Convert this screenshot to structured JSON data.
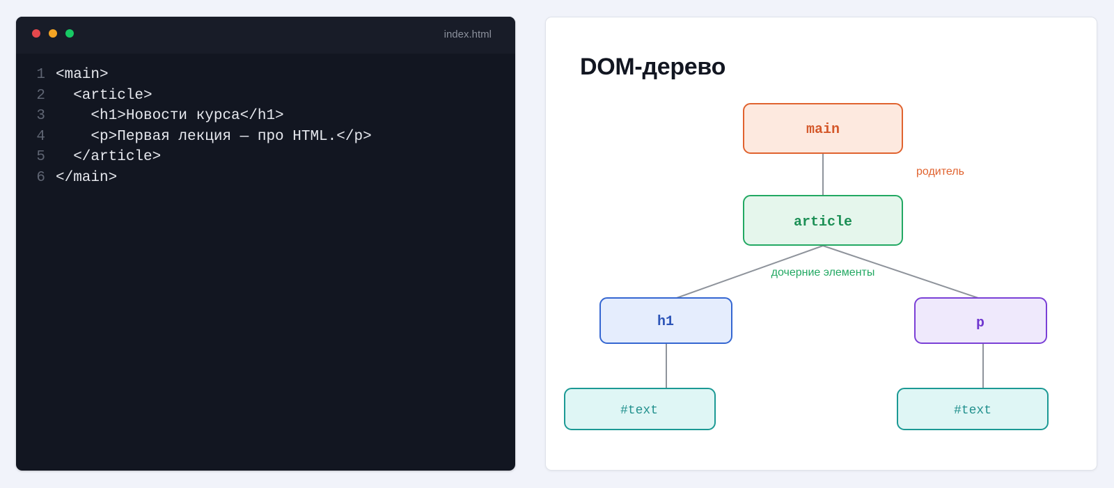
{
  "editor": {
    "filename": "index.html",
    "lines": [
      {
        "num": "1",
        "text": "<main>"
      },
      {
        "num": "2",
        "text": "  <article>"
      },
      {
        "num": "3",
        "text": "    <h1>Новости курса</h1>"
      },
      {
        "num": "4",
        "text": "    <p>Первая лекция — про HTML.</p>"
      },
      {
        "num": "5",
        "text": "  </article>"
      },
      {
        "num": "6",
        "text": "</main>"
      }
    ],
    "colors": {
      "dot_red": "#e5484d",
      "dot_yellow": "#f5a524",
      "dot_green": "#17c964"
    }
  },
  "diagram": {
    "title": "DOM-дерево",
    "nodes": {
      "main": {
        "label": "main",
        "fill": "#fde9df",
        "stroke": "#e0622e",
        "color": "#d4582a"
      },
      "article": {
        "label": "article",
        "fill": "#e5f6ec",
        "stroke": "#22a862",
        "color": "#1c8f55"
      },
      "h1": {
        "label": "h1",
        "fill": "#e5edfd",
        "stroke": "#3466d1",
        "color": "#2d55b8"
      },
      "p": {
        "label": "p",
        "fill": "#efe9fc",
        "stroke": "#7a3fd6",
        "color": "#6f36cf"
      },
      "text_h1": {
        "label": "#text",
        "fill": "#dff6f5",
        "stroke": "#1b9994",
        "color": "#23918e"
      },
      "text_p": {
        "label": "#text",
        "fill": "#dff6f5",
        "stroke": "#1b9994",
        "color": "#23918e"
      }
    },
    "annotations": {
      "parent": {
        "text": "родитель",
        "color": "#e0622e"
      },
      "children": {
        "text": "дочерние элементы",
        "color": "#22a862"
      }
    },
    "edge_color": "#8e939b"
  }
}
